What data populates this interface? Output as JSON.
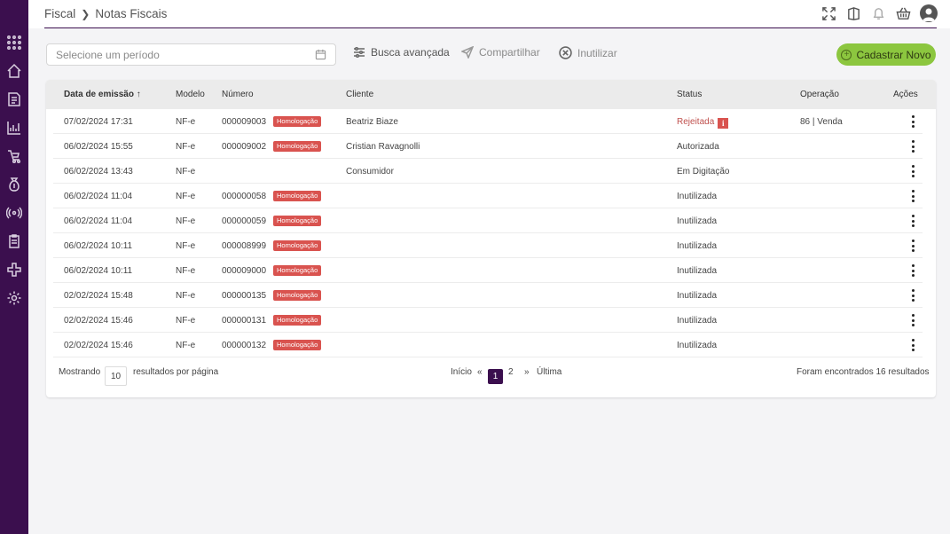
{
  "breadcrumb": {
    "root": "Fiscal",
    "current": "Notas Fiscais"
  },
  "toolbar": {
    "date_placeholder": "Selecione um período",
    "advanced_search": "Busca avançada",
    "share": "Compartilhar",
    "inutilize": "Inutilizar",
    "new_button": "Cadastrar Novo"
  },
  "table": {
    "headers": {
      "date": "Data de emissão",
      "sort_arrow": "↑",
      "model": "Modelo",
      "number": "Número",
      "client": "Cliente",
      "status": "Status",
      "operation": "Operação",
      "actions": "Ações"
    },
    "rows": [
      {
        "date": "07/02/2024 17:31",
        "model": "NF-e",
        "number": "000009003",
        "badge": "Homologação",
        "client": "Beatriz Biaze",
        "status": "Rejeitada",
        "info": "i",
        "operation": "86 | Venda"
      },
      {
        "date": "06/02/2024 15:55",
        "model": "NF-e",
        "number": "000009002",
        "badge": "Homologação",
        "client": "Cristian Ravagnolli",
        "status": "Autorizada",
        "info": "",
        "operation": ""
      },
      {
        "date": "06/02/2024 13:43",
        "model": "NF-e",
        "number": "",
        "badge": "",
        "client": "Consumidor",
        "status": "Em Digitação",
        "info": "",
        "operation": ""
      },
      {
        "date": "06/02/2024 11:04",
        "model": "NF-e",
        "number": "000000058",
        "badge": "Homologação",
        "client": "",
        "status": "Inutilizada",
        "info": "",
        "operation": ""
      },
      {
        "date": "06/02/2024 11:04",
        "model": "NF-e",
        "number": "000000059",
        "badge": "Homologação",
        "client": "",
        "status": "Inutilizada",
        "info": "",
        "operation": ""
      },
      {
        "date": "06/02/2024 10:11",
        "model": "NF-e",
        "number": "000008999",
        "badge": "Homologação",
        "client": "",
        "status": "Inutilizada",
        "info": "",
        "operation": ""
      },
      {
        "date": "06/02/2024 10:11",
        "model": "NF-e",
        "number": "000009000",
        "badge": "Homologação",
        "client": "",
        "status": "Inutilizada",
        "info": "",
        "operation": ""
      },
      {
        "date": "02/02/2024 15:48",
        "model": "NF-e",
        "number": "000000135",
        "badge": "Homologação",
        "client": "",
        "status": "Inutilizada",
        "info": "",
        "operation": ""
      },
      {
        "date": "02/02/2024 15:46",
        "model": "NF-e",
        "number": "000000131",
        "badge": "Homologação",
        "client": "",
        "status": "Inutilizada",
        "info": "",
        "operation": ""
      },
      {
        "date": "02/02/2024 15:46",
        "model": "NF-e",
        "number": "000000132",
        "badge": "Homologação",
        "client": "",
        "status": "Inutilizada",
        "info": "",
        "operation": ""
      }
    ]
  },
  "footer": {
    "showing": "Mostrando",
    "per_page": "10",
    "per_page_suffix": "resultados por página",
    "first": "Início",
    "prev": "«",
    "page1": "1",
    "page2": "2",
    "next": "»",
    "last": "Última",
    "total": "Foram encontrados 16 resultados"
  },
  "colors": {
    "sidebar": "#3b0f4e",
    "accent_green": "#8cc63f",
    "badge_red": "#d9534f"
  }
}
